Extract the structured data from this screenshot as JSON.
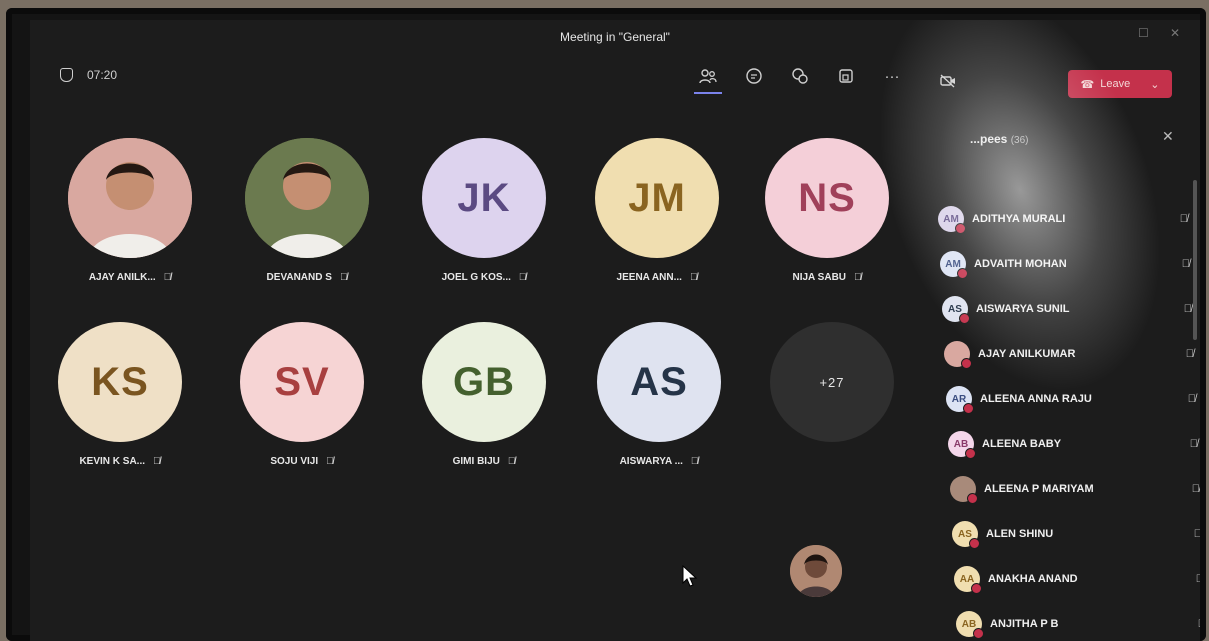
{
  "window": {
    "title": "Meeting in \"General\""
  },
  "meeting": {
    "timer": "07:20",
    "leave_label": "Leave"
  },
  "tiles": [
    {
      "initials": "",
      "name": "AJAY ANILK...",
      "bg": "#d9a8a0",
      "fg": "#5a3a3a",
      "photo": true
    },
    {
      "initials": "",
      "name": "DEVANAND S",
      "bg": "#6b7a4f",
      "fg": "#333",
      "photo": true
    },
    {
      "initials": "JK",
      "name": "JOEL G KOS...",
      "bg": "#ddd3ee",
      "fg": "#5b4a82"
    },
    {
      "initials": "JM",
      "name": "JEENA ANN...",
      "bg": "#f0deb0",
      "fg": "#8a6420"
    },
    {
      "initials": "NS",
      "name": "NIJA SABU",
      "bg": "#f4cfd8",
      "fg": "#a0405a"
    },
    {
      "initials": "KS",
      "name": "KEVIN K SA...",
      "bg": "#efe0c6",
      "fg": "#7a5520"
    },
    {
      "initials": "SV",
      "name": "SOJU VIJI",
      "bg": "#f6d4d4",
      "fg": "#a84040"
    },
    {
      "initials": "GB",
      "name": "GIMI BIJU",
      "bg": "#eaf0de",
      "fg": "#44602e"
    },
    {
      "initials": "AS",
      "name": "AISWARYA ...",
      "bg": "#dfe3f0",
      "fg": "#253448"
    }
  ],
  "overflow_tile": {
    "label": "+27"
  },
  "participants_panel": {
    "title": "...pees",
    "count": "(36)",
    "list": [
      {
        "initials": "AM",
        "name": "ADITHYA MURALI",
        "bg": "#d8d0e8",
        "fg": "#5b4a82"
      },
      {
        "initials": "AM",
        "name": "ADVAITH MOHAN",
        "bg": "#dce3f4",
        "fg": "#3a4d80"
      },
      {
        "initials": "AS",
        "name": "AISWARYA SUNIL",
        "bg": "#dfe3f0",
        "fg": "#253448"
      },
      {
        "initials": "",
        "name": "AJAY ANILKUMAR",
        "bg": "#d9a8a0",
        "fg": "#5a3a3a"
      },
      {
        "initials": "AR",
        "name": "ALEENA ANNA RAJU",
        "bg": "#dce3f4",
        "fg": "#3a4d80"
      },
      {
        "initials": "AB",
        "name": "ALEENA BABY",
        "bg": "#f4d6ea",
        "fg": "#8a3a6a"
      },
      {
        "initials": "",
        "name": "ALEENA P MARIYAM",
        "bg": "#a88a7a",
        "fg": "#333"
      },
      {
        "initials": "AS",
        "name": "ALEN SHINU",
        "bg": "#f0deb0",
        "fg": "#8a6420"
      },
      {
        "initials": "AA",
        "name": "ANAKHA ANAND",
        "bg": "#f0deb0",
        "fg": "#8a6420"
      },
      {
        "initials": "AB",
        "name": "ANJITHA P B",
        "bg": "#f0deb0",
        "fg": "#8a6420"
      }
    ]
  },
  "icons": {
    "shield": "shield-icon",
    "participants": "people-icon",
    "chat": "chat-icon",
    "reactions": "reactions-icon",
    "rooms": "rooms-icon",
    "more": "more-icon",
    "camera": "camera-off-icon",
    "phone": "phone-icon",
    "mic_off": "mic-off-icon"
  }
}
